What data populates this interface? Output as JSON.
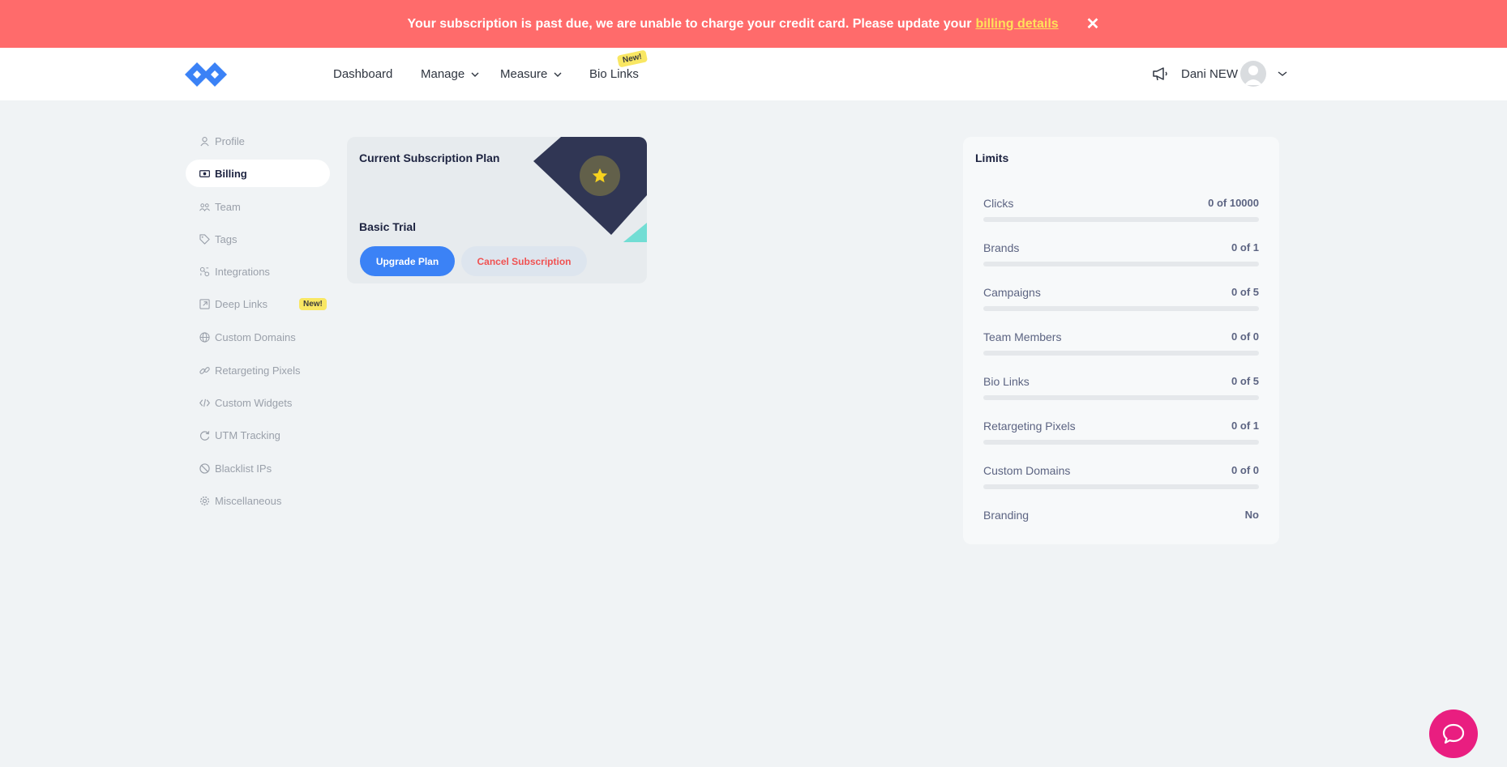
{
  "banner": {
    "message": "Your subscription is past due, we are unable to charge your credit card. Please update your",
    "link_label": "billing details",
    "close_label": "✕"
  },
  "header": {
    "nav": [
      {
        "label": "Dashboard",
        "has_dropdown": false
      },
      {
        "label": "Manage",
        "has_dropdown": true
      },
      {
        "label": "Measure",
        "has_dropdown": true
      },
      {
        "label": "Bio Links",
        "has_dropdown": false
      }
    ],
    "new_badge": "New!",
    "user_name": "Dani NEW"
  },
  "sidebar": {
    "items": [
      {
        "label": "Profile",
        "icon": "user-icon",
        "active": false
      },
      {
        "label": "Billing",
        "icon": "money-icon",
        "active": true
      },
      {
        "label": "Team",
        "icon": "team-icon",
        "active": false
      },
      {
        "label": "Tags",
        "icon": "tag-icon",
        "active": false
      },
      {
        "label": "Integrations",
        "icon": "integrations-icon",
        "active": false
      },
      {
        "label": "Deep Links",
        "icon": "external-link-icon",
        "active": false
      },
      {
        "label": "Custom Domains",
        "icon": "globe-icon",
        "active": false
      },
      {
        "label": "Retargeting Pixels",
        "icon": "link-icon",
        "active": false
      },
      {
        "label": "Custom Widgets",
        "icon": "code-icon",
        "active": false
      },
      {
        "label": "UTM Tracking",
        "icon": "refresh-icon",
        "active": false
      },
      {
        "label": "Blacklist IPs",
        "icon": "ban-icon",
        "active": false
      },
      {
        "label": "Miscellaneous",
        "icon": "gear-icon",
        "active": false
      }
    ],
    "deep_links_badge": "New!"
  },
  "subscription": {
    "title": "Current Subscription Plan",
    "plan_name": "Basic Trial",
    "upgrade_label": "Upgrade Plan",
    "cancel_label": "Cancel Subscription"
  },
  "limits": {
    "title": "Limits",
    "rows": [
      {
        "label": "Clicks",
        "value": "0 of 10000",
        "fraction": 0
      },
      {
        "label": "Brands",
        "value": "0 of 1",
        "fraction": 0
      },
      {
        "label": "Campaigns",
        "value": "0 of 5",
        "fraction": 0
      },
      {
        "label": "Team Members",
        "value": "0 of 0",
        "fraction": 0
      },
      {
        "label": "Bio Links",
        "value": "0 of 5",
        "fraction": 0
      },
      {
        "label": "Retargeting Pixels",
        "value": "0 of 1",
        "fraction": 0
      },
      {
        "label": "Custom Domains",
        "value": "0 of 0",
        "fraction": 0
      },
      {
        "label": "Branding",
        "value": "No"
      }
    ]
  },
  "colors": {
    "banner": "#ff6b6b",
    "banner_link": "#ffe15a",
    "primary": "#3b82f6",
    "danger": "#f05252",
    "badge": "#f9e763",
    "chat": "#e91e80"
  }
}
